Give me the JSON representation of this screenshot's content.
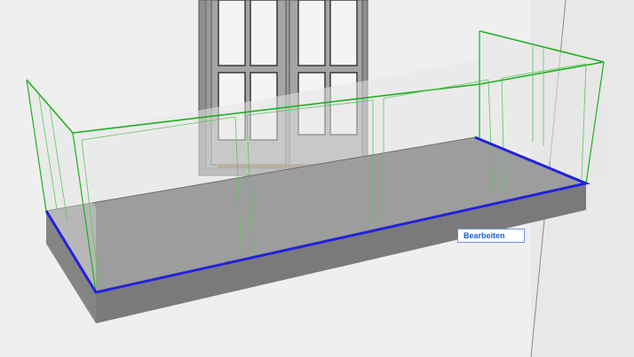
{
  "viewport": {
    "context_tooltip": "Bearbeiten",
    "colors": {
      "wall": "#efefef",
      "wall_side": "#e6e6e6",
      "door_frame": "#8e8e8e",
      "glass": "#eeeeee",
      "slab_top": "#9d9d9d",
      "slab_front": "#7a7a7a",
      "railing_outline": "#1fb01f",
      "selected_edge": "#2222dd"
    }
  }
}
